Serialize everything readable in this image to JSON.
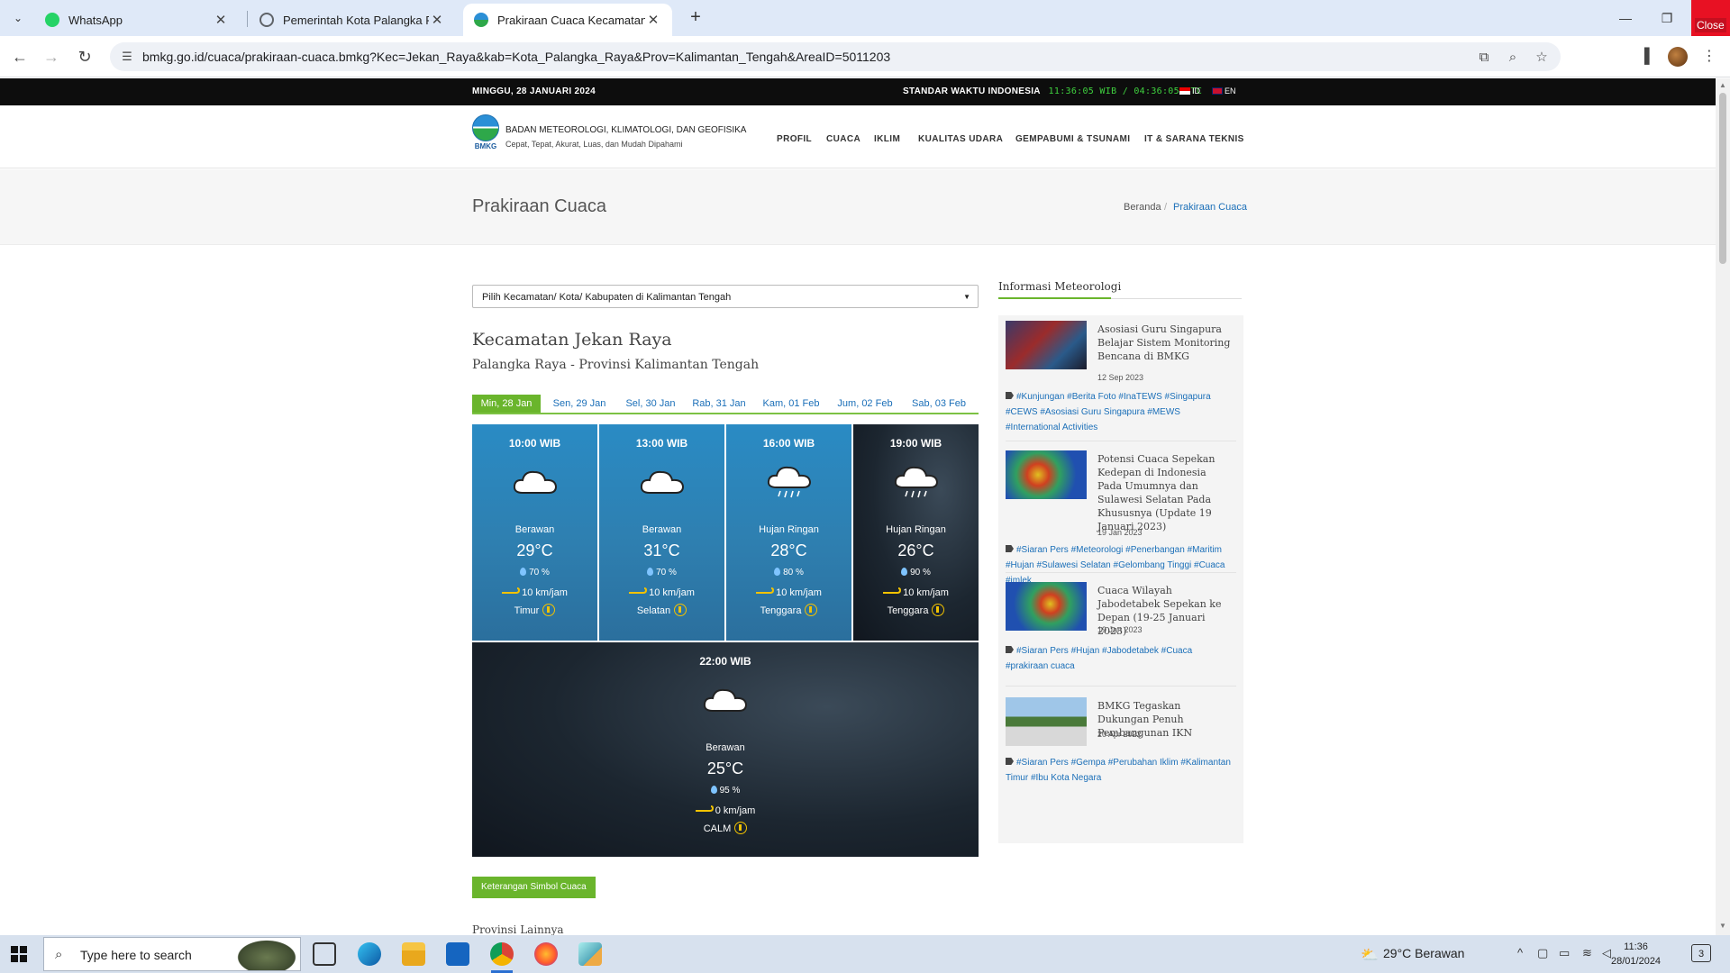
{
  "browser": {
    "tabs": [
      {
        "title": "WhatsApp",
        "favicon_color": "#25d366"
      },
      {
        "title": "Pemerintah Kota Palangka Raya",
        "favicon_color": "#5f6368"
      },
      {
        "title": "Prakiraan Cuaca Kecamatan Jekan Raya",
        "favicon_color": "#2b8fd6"
      }
    ],
    "new_tab": "+",
    "url": "bmkg.go.id/cuaca/prakiraan-cuaca.bmkg?Kec=Jekan_Raya&kab=Kota_Palangka_Raya&Prov=Kalimantan_Tengah&AreaID=5011203",
    "close_tooltip": "Close"
  },
  "topstrip": {
    "date": "MINGGU, 28 JANUARI 2024",
    "std_label": "STANDAR WAKTU INDONESIA",
    "time": "11:36:05 WIB / 04:36:05 UTC",
    "lang_id": "ID",
    "lang_en": "EN"
  },
  "header": {
    "logo_text": "BMKG",
    "org": "BADAN METEOROLOGI, KLIMATOLOGI, DAN GEOFISIKA",
    "tagline": "Cepat, Tepat, Akurat, Luas, dan Mudah Dipahami",
    "menu": [
      "PROFIL",
      "CUACA",
      "IKLIM",
      "KUALITAS UDARA",
      "GEMPABUMI & TSUNAMI",
      "IT & SARANA TEKNIS"
    ]
  },
  "titlebar": {
    "title": "Prakiraan Cuaca",
    "breadcrumb": [
      "Beranda",
      "/",
      "Prakiraan Cuaca"
    ]
  },
  "main": {
    "select_value": "Pilih Kecamatan/ Kota/ Kabupaten di Kalimantan Tengah",
    "kecamatan": "Kecamatan Jekan Raya",
    "kabupaten": "Palangka Raya - Provinsi Kalimantan Tengah",
    "day_tabs": [
      "Min, 28 Jan",
      "Sen, 29 Jan",
      "Sel, 30 Jan",
      "Rab, 31 Jan",
      "Kam, 01 Feb",
      "Jum, 02 Feb",
      "Sab, 03 Feb"
    ],
    "forecasts": [
      {
        "time": "10:00 WIB",
        "condition": "Berawan",
        "temp": "29°C",
        "humidity": "70 %",
        "wind": "10 km/jam",
        "direction": "Timur",
        "icon": "cloud-icon"
      },
      {
        "time": "13:00 WIB",
        "condition": "Berawan",
        "temp": "31°C",
        "humidity": "70 %",
        "wind": "10 km/jam",
        "direction": "Selatan",
        "icon": "cloud-icon"
      },
      {
        "time": "16:00 WIB",
        "condition": "Hujan Ringan",
        "temp": "28°C",
        "humidity": "80 %",
        "wind": "10 km/jam",
        "direction": "Tenggara",
        "icon": "light-rain-icon"
      },
      {
        "time": "19:00 WIB",
        "condition": "Hujan Ringan",
        "temp": "26°C",
        "humidity": "90 %",
        "wind": "10 km/jam",
        "direction": "Tenggara",
        "icon": "light-rain-icon"
      },
      {
        "time": "22:00 WIB",
        "condition": "Berawan",
        "temp": "25°C",
        "humidity": "95 %",
        "wind": "0 km/jam",
        "direction": "CALM",
        "icon": "cloud-icon"
      }
    ],
    "legend_button": "Keterangan Simbol Cuaca",
    "provinsi_lainnya": "Provinsi Lainnya"
  },
  "sidebar": {
    "title": "Informasi Meteorologi",
    "news": [
      {
        "title": "Asosiasi Guru Singapura Belajar Sistem Monitoring Bencana di BMKG",
        "date": "12 Sep 2023",
        "tags": "#Kunjungan #Berita Foto #InaTEWS #Singapura #CEWS #Asosiasi Guru Singapura #MEWS #International Activities"
      },
      {
        "title": "Potensi Cuaca Sepekan Kedepan di Indonesia Pada Umumnya dan Sulawesi Selatan Pada Khususnya (Update 19 Januari 2023)",
        "date": "19 Jan 2023",
        "tags": "#Siaran Pers #Meteorologi #Penerbangan #Maritim #Hujan #Sulawesi Selatan #Gelombang Tinggi #Cuaca #imlek"
      },
      {
        "title": "Cuaca Wilayah Jabodetabek Sepekan ke Depan (19-25 Januari 2023)",
        "date": "19 Jan 2023",
        "tags": "#Siaran Pers #Hujan #Jabodetabek #Cuaca #prakiraan cuaca"
      },
      {
        "title": "BMKG Tegaskan Dukungan Penuh Pembangunan IKN",
        "date": "20 Apr 2022",
        "tags": "#Siaran Pers #Gempa #Perubahan Iklim #Kalimantan Timur #Ibu Kota Negara"
      }
    ]
  },
  "taskbar": {
    "search_placeholder": "Type here to search",
    "weather": "29°C  Berawan",
    "time": "11:36",
    "date": "28/01/2024",
    "notif_count": "3"
  }
}
